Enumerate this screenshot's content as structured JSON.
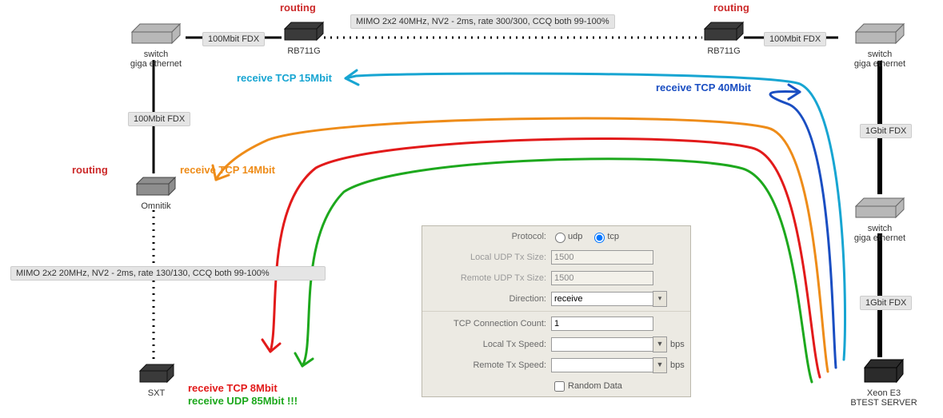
{
  "nodes": {
    "switch_left": {
      "label": "switch\ngiga ethernet"
    },
    "rb711g_left": {
      "label": "RB711G"
    },
    "rb711g_right": {
      "label": "RB711G"
    },
    "switch_right_top": {
      "label": "switch\ngiga ethernet"
    },
    "omnitik": {
      "label": "Omnitik"
    },
    "sxt": {
      "label": "SXT"
    },
    "switch_right_mid": {
      "label": "switch\ngiga ethernet"
    },
    "server": {
      "label": "Xeon E3\nBTEST SERVER"
    }
  },
  "links": {
    "l1": "100Mbit FDX",
    "l2": "100Mbit FDX",
    "l3": "100Mbit FDX",
    "l4": "1Gbit FDX",
    "l5": "1Gbit FDX",
    "wlan_top": "MIMO 2x2 40MHz, NV2 - 2ms, rate 300/300, CCQ both 99-100%",
    "wlan_left": "MIMO 2x2 20MHz, NV2 - 2ms, rate 130/130, CCQ both 99-100%"
  },
  "captions": {
    "routing": "routing"
  },
  "flows": {
    "cyan": "receive TCP 15Mbit",
    "blue": "receive TCP 40Mbit",
    "orange": "receive TCP 14Mbit",
    "red": "receive TCP 8Mbit",
    "green": "receive UDP 85Mbit !!!"
  },
  "panel": {
    "protocol_label": "Protocol:",
    "udp": "udp",
    "tcp": "tcp",
    "local_udp_label": "Local UDP Tx Size:",
    "local_udp_val": "1500",
    "remote_udp_label": "Remote UDP Tx Size:",
    "remote_udp_val": "1500",
    "direction_label": "Direction:",
    "direction_val": "receive",
    "tcp_conn_label": "TCP Connection Count:",
    "tcp_conn_val": "1",
    "local_tx_label": "Local Tx Speed:",
    "local_tx_val": "",
    "remote_tx_label": "Remote Tx Speed:",
    "remote_tx_val": "",
    "bps": "bps",
    "random_data": "Random Data"
  }
}
